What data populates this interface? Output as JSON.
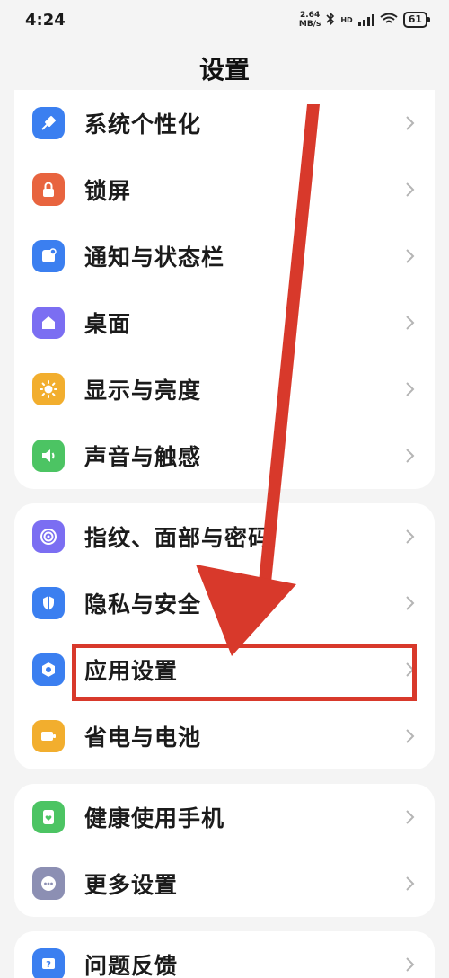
{
  "status": {
    "time": "4:24",
    "net_speed_top": "2.64",
    "net_speed_bottom": "MB/s",
    "hd": "HD",
    "battery": "61"
  },
  "title": "设置",
  "groups": [
    {
      "items": [
        {
          "label": "系统个性化",
          "icon": "brush-icon",
          "color": "#3b7ff0"
        },
        {
          "label": "锁屏",
          "icon": "lock-icon",
          "color": "#e8643f"
        },
        {
          "label": "通知与状态栏",
          "icon": "notification-icon",
          "color": "#3b7ff0"
        },
        {
          "label": "桌面",
          "icon": "home-icon",
          "color": "#7b6ef2"
        },
        {
          "label": "显示与亮度",
          "icon": "sun-icon",
          "color": "#f2ae2e"
        },
        {
          "label": "声音与触感",
          "icon": "speaker-icon",
          "color": "#4cc463"
        }
      ]
    },
    {
      "items": [
        {
          "label": "指纹、面部与密码",
          "icon": "fingerprint-icon",
          "color": "#7b6ef2"
        },
        {
          "label": "隐私与安全",
          "icon": "privacy-icon",
          "color": "#3b7ff0"
        },
        {
          "label": "应用设置",
          "icon": "app-settings-icon",
          "color": "#3b7ff0"
        },
        {
          "label": "省电与电池",
          "icon": "battery-icon",
          "color": "#f2ae2e"
        }
      ]
    },
    {
      "items": [
        {
          "label": "健康使用手机",
          "icon": "health-icon",
          "color": "#4cc463"
        },
        {
          "label": "更多设置",
          "icon": "more-icon",
          "color": "#8c8fb3"
        }
      ]
    },
    {
      "items": [
        {
          "label": "问题反馈",
          "icon": "feedback-icon",
          "color": "#3b7ff0"
        }
      ]
    }
  ],
  "annotation_color": "#d8392b"
}
